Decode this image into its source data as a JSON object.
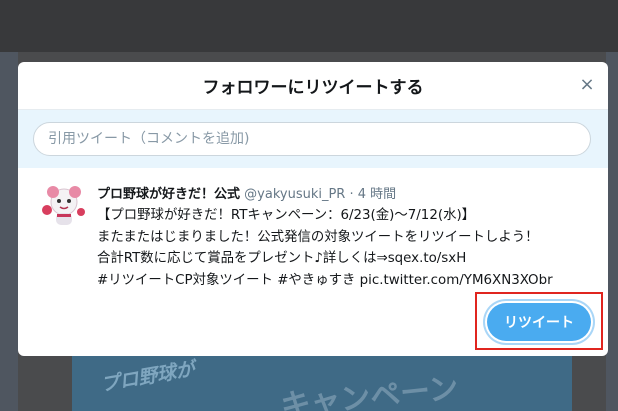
{
  "modal": {
    "title": "フォロワーにリツイートする",
    "close_glyph": "×"
  },
  "quote": {
    "placeholder": "引用ツイート（コメントを追加)"
  },
  "tweet": {
    "author_name": "プロ野球が好きだ！公式",
    "handle": "@yakyusuki_PR",
    "separator": "·",
    "time": "4 時間",
    "lines": [
      "【プロ野球が好きだ！RTキャンペーン：6/23(金)〜7/12(水)】",
      "またまたはじまりました！公式発信の対象ツイートをリツイートしよう！",
      "合計RT数に応じて賞品をプレゼント♪詳しくは⇒sqex.to/sxH",
      "#リツイートCP対象ツイート #やきゅすき pic.twitter.com/YM6XN3XObr"
    ]
  },
  "actions": {
    "retweet_label": "リツイート"
  },
  "background": {
    "banner_text_1": "プロ野球が",
    "banner_text_2": "キャンペーン"
  },
  "colors": {
    "accent": "#4aabf0",
    "highlight": "#e0251f",
    "quote_bg": "#e8f5fd"
  }
}
